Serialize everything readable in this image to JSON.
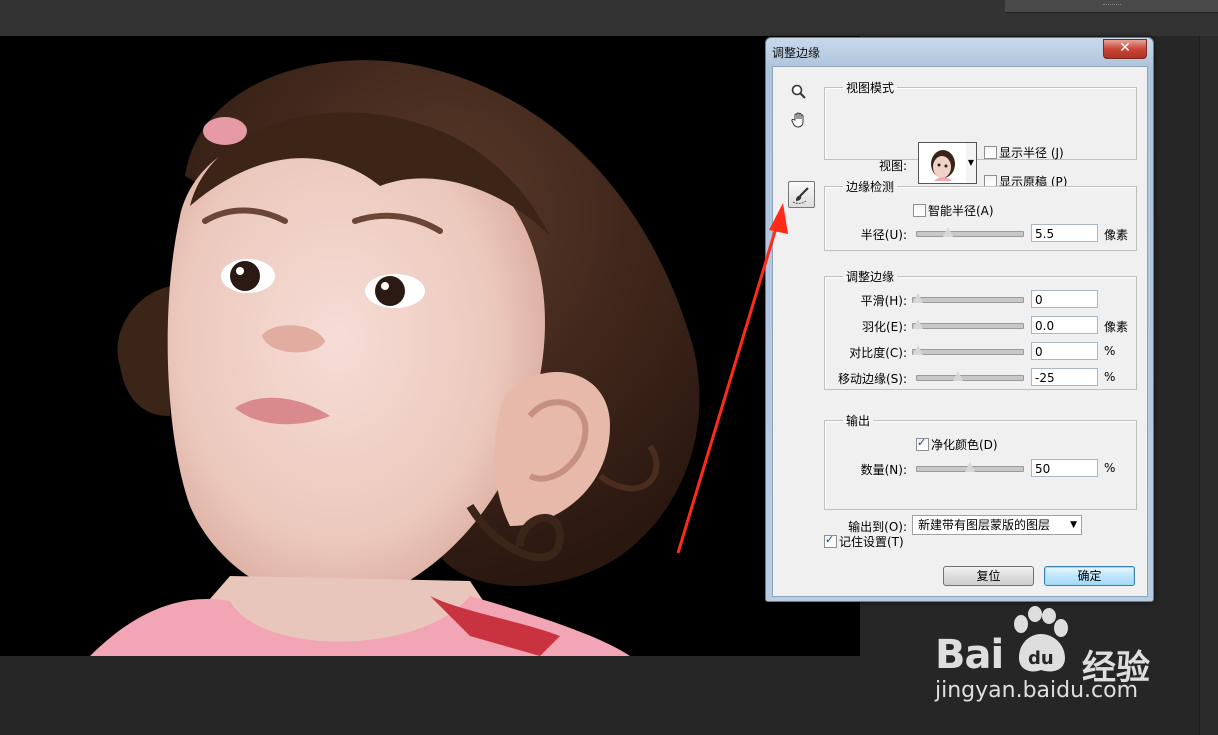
{
  "dialog": {
    "title": "调整边缘",
    "close_glyph": "✕",
    "view_mode": {
      "legend": "视图模式",
      "view_label": "视图:",
      "show_radius": "显示半径 (J)",
      "show_original": "显示原稿 (P)",
      "show_radius_checked": false,
      "show_original_checked": false
    },
    "edge_detection": {
      "legend": "边缘检测",
      "smart_radius": "智能半径(A)",
      "smart_radius_checked": false,
      "radius_label": "半径(U):",
      "radius_value": "5.5",
      "radius_unit": "像素",
      "radius_slider": 0.27
    },
    "adjust_edge": {
      "legend": "调整边缘",
      "smooth_label": "平滑(H):",
      "smooth_value": "0",
      "feather_label": "羽化(E):",
      "feather_value": "0.0",
      "feather_unit": "像素",
      "contrast_label": "对比度(C):",
      "contrast_value": "0",
      "contrast_unit": "%",
      "shift_label": "移动边缘(S):",
      "shift_value": "-25",
      "shift_unit": "%",
      "smooth_slider": 0,
      "feather_slider": 0,
      "contrast_slider": 0,
      "shift_slider": 0.375
    },
    "output": {
      "legend": "输出",
      "decontaminate": "净化颜色(D)",
      "decontaminate_checked": true,
      "amount_label": "数量(N):",
      "amount_value": "50",
      "amount_unit": "%",
      "amount_slider": 0.5,
      "output_to_label": "输出到(O):",
      "output_to_value": "新建带有图层蒙版的图层"
    },
    "remember": "记住设置(T)",
    "remember_checked": true,
    "reset_button": "复位",
    "ok_button": "确定"
  },
  "tools": [
    "zoom-icon",
    "hand-icon",
    "refine-radius-brush-icon"
  ],
  "annotation_color": "#ff2a1a",
  "watermark": {
    "logo": "Bai",
    "logo_du": "du",
    "brand_cn": "经验",
    "url": "jingyan.baidu.com"
  }
}
